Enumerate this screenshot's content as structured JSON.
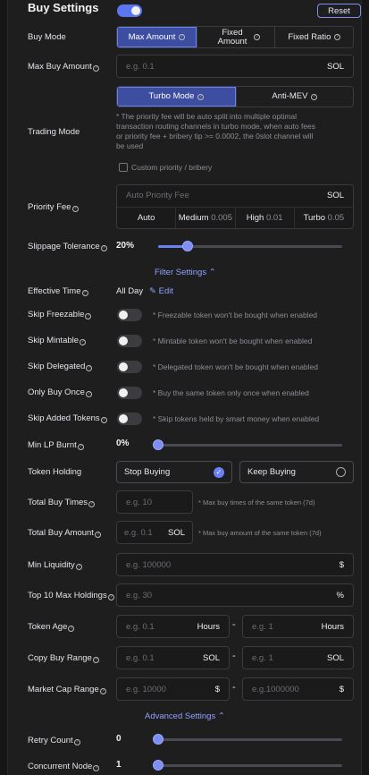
{
  "header": {
    "title": "Buy Settings",
    "reset_label": "Reset"
  },
  "buy_mode": {
    "label": "Buy Mode",
    "options": [
      "Max Amount",
      "Fixed Amount",
      "Fixed Ratio"
    ],
    "selected": "Max Amount"
  },
  "max_buy_amount": {
    "label": "Max Buy Amount",
    "placeholder": "e.g. 0.1",
    "unit": "SOL"
  },
  "trading_mode": {
    "label": "Trading Mode",
    "options": [
      "Turbo Mode",
      "Anti-MEV"
    ],
    "selected": "Turbo Mode",
    "note_lines": [
      "* The priority fee will be auto split into multiple optimal",
      "transaction routing channels in turbo mode, when auto fees",
      "or priority fee + bribery tip >= 0.0002, the 0slot channel will",
      "be used"
    ],
    "custom_label": "Custom priority / bribery"
  },
  "priority_fee": {
    "label": "Priority Fee",
    "placeholder": "Auto Priority Fee",
    "unit": "SOL",
    "presets": [
      {
        "name": "Auto",
        "value": ""
      },
      {
        "name": "Medium",
        "value": "0.005"
      },
      {
        "name": "High",
        "value": "0.01"
      },
      {
        "name": "Turbo",
        "value": "0.05"
      }
    ]
  },
  "slippage": {
    "label": "Slippage Tolerance",
    "value_text": "20%",
    "fraction": 0.16
  },
  "filter_settings_label": "Filter Settings",
  "effective_time": {
    "label": "Effective Time",
    "value": "All Day",
    "edit_label": "Edit"
  },
  "skip_freezable": {
    "label": "Skip Freezable",
    "note": "* Freezable token won't be bought when enabled"
  },
  "skip_mintable": {
    "label": "Skip Mintable",
    "note": "* Mintable token won't be bought when enabled"
  },
  "skip_delegated": {
    "label": "Skip Delegated",
    "note": "* Delegated token won't be bought when enabled"
  },
  "only_buy_once": {
    "label": "Only Buy Once",
    "note": "* Buy the same token only once when enabled"
  },
  "skip_added_tokens": {
    "label": "Skip Added Tokens",
    "note": "* Skip tokens held by smart money when enabled"
  },
  "min_lp_burnt": {
    "label": "Min LP Burnt",
    "value_text": "0%",
    "fraction": 0.0
  },
  "token_holding": {
    "label": "Token Holding",
    "options": [
      "Stop Buying",
      "Keep Buying"
    ],
    "selected": "Stop Buying"
  },
  "total_buy_times": {
    "label": "Total Buy Times",
    "placeholder": "e.g. 10",
    "note": "* Max buy times of the same token (7d)"
  },
  "total_buy_amount": {
    "label": "Total Buy Amount",
    "placeholder": "e.g. 0.1",
    "unit": "SOL",
    "note": "* Max buy amount of the same token (7d)"
  },
  "min_liquidity": {
    "label": "Min Liquidity",
    "placeholder": "e.g. 100000",
    "unit": "$"
  },
  "top10_max": {
    "label": "Top 10 Max Holdings",
    "placeholder": "e.g. 30",
    "unit": "%"
  },
  "token_age": {
    "label": "Token Age",
    "min_placeholder": "e.g. 0.1",
    "max_placeholder": "e.g. 1",
    "unit": "Hours"
  },
  "copy_buy_range": {
    "label": "Copy Buy Range",
    "min_placeholder": "e.g. 0.1",
    "max_placeholder": "e.g. 1",
    "unit": "SOL"
  },
  "market_cap_range": {
    "label": "Market Cap Range",
    "min_placeholder": "e.g. 10000",
    "max_placeholder": "e.g.1000000",
    "unit": "$"
  },
  "advanced_settings_label": "Advanced Settings",
  "retry_count": {
    "label": "Retry Count",
    "value_text": "0",
    "fraction": 0.0
  },
  "concurrent_node": {
    "label": "Concurrent Node",
    "value_text": "1",
    "fraction": 0.0
  },
  "colors": {
    "accent": "#6a80f5",
    "selected_bg": "#3d4da0",
    "panel_bg": "#1e1e1f"
  }
}
